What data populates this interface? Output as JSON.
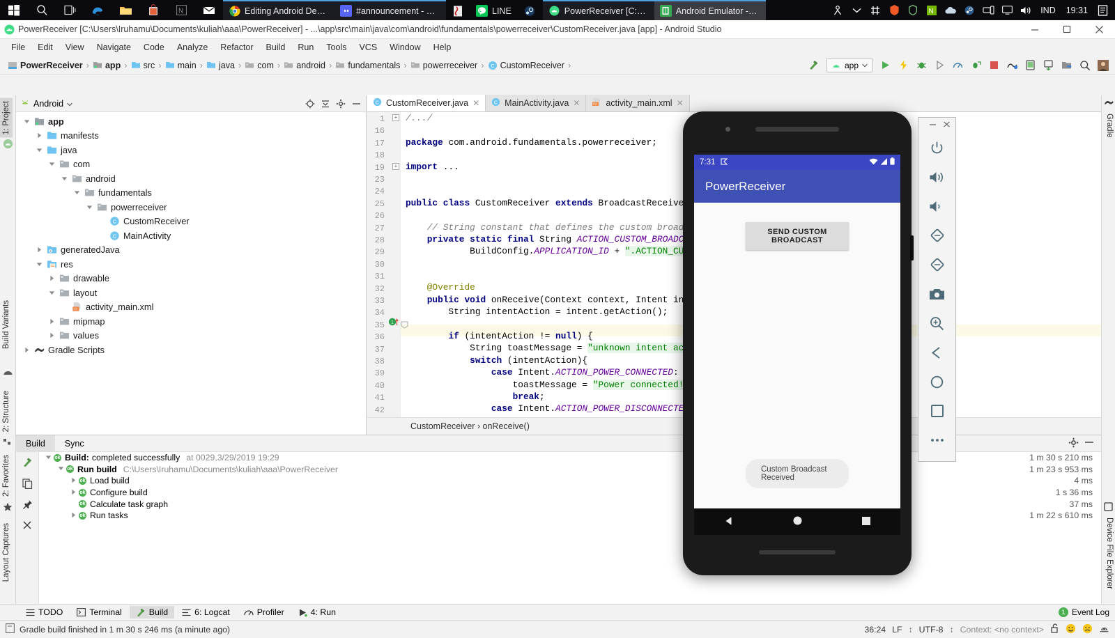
{
  "taskbar": {
    "start_label": "start-menu",
    "pinned": [
      "search-icon",
      "task-view-icon",
      "edge-icon",
      "file-explorer-icon",
      "store-icon",
      "onenote-icon",
      "mail-icon"
    ],
    "tasks": [
      {
        "label": "Editing Android Dev…",
        "icon": "chrome-icon",
        "state": "open"
      },
      {
        "label": "#announcement - D…",
        "icon": "discord-icon",
        "state": "open"
      },
      {
        "label": "",
        "icon": "pdf-icon",
        "state": "plain"
      },
      {
        "label": "LINE",
        "icon": "line-icon",
        "state": "plain"
      },
      {
        "label": "",
        "icon": "steam-icon",
        "state": "plain"
      },
      {
        "label": "PowerReceiver [C:\\U…",
        "icon": "android-studio-icon",
        "state": "open"
      },
      {
        "label": "Android Emulator - …",
        "icon": "emulator-icon",
        "state": "active"
      }
    ],
    "tray_icons": [
      "people-icon",
      "chevron-up-icon",
      "slack-icon",
      "avast-icon",
      "shield-icon",
      "nvidia-icon",
      "onedrive-icon",
      "steam-tray-icon",
      "network-icon",
      "display-icon",
      "volume-icon"
    ],
    "language": "IND",
    "clock": "19:31",
    "notification_icon": "notification-icon"
  },
  "window": {
    "title": "PowerReceiver [C:\\Users\\Iruhamu\\Documents\\kuliah\\aaa\\PowerReceiver] - ...\\app\\src\\main\\java\\com\\android\\fundamentals\\powerreceiver\\CustomReceiver.java [app] - Android Studio",
    "minimize": "—",
    "maximize": "❐",
    "close": "✕"
  },
  "menu": [
    "File",
    "Edit",
    "View",
    "Navigate",
    "Code",
    "Analyze",
    "Refactor",
    "Build",
    "Run",
    "Tools",
    "VCS",
    "Window",
    "Help"
  ],
  "breadcrumb": [
    {
      "label": "PowerReceiver",
      "icon": "module-icon",
      "bold": true
    },
    {
      "label": "app",
      "icon": "app-module-icon",
      "bold": true
    },
    {
      "label": "src",
      "icon": "folder-icon",
      "bold": false
    },
    {
      "label": "main",
      "icon": "folder-icon",
      "bold": false
    },
    {
      "label": "java",
      "icon": "java-folder-icon",
      "bold": false
    },
    {
      "label": "com",
      "icon": "package-icon",
      "bold": false
    },
    {
      "label": "android",
      "icon": "package-icon",
      "bold": false
    },
    {
      "label": "fundamentals",
      "icon": "package-icon",
      "bold": false
    },
    {
      "label": "powerreceiver",
      "icon": "package-icon",
      "bold": false
    },
    {
      "label": "CustomReceiver",
      "icon": "class-icon",
      "bold": false
    }
  ],
  "toolbar": {
    "run_config": "app",
    "buttons": [
      "build-icon",
      "run-icon",
      "debug-icon",
      "run-with-coverage-icon",
      "attach-debugger-icon",
      "profiler-icon",
      "apply-changes-icon",
      "stop-icon",
      "sync-gradle-icon",
      "avd-manager-icon",
      "sdk-manager-icon",
      "project-structure-icon",
      "search-everywhere-icon",
      "user-avatar"
    ]
  },
  "left_strip": [
    {
      "label": "1: Project",
      "selected": true
    },
    {
      "label": "Build Variants",
      "selected": false
    },
    {
      "label": "2: Structure",
      "selected": false
    },
    {
      "label": "2: Favorites",
      "selected": false
    },
    {
      "label": "Layout Captures",
      "selected": false
    }
  ],
  "right_strip": [
    {
      "label": "Gradle",
      "icon": "gradle-icon"
    },
    {
      "label": "Device File Explorer",
      "icon": "device-icon"
    }
  ],
  "project": {
    "view_name": "Android",
    "actions": [
      "locate-icon",
      "collapse-all-icon",
      "settings-icon",
      "hide-icon"
    ],
    "tree": [
      {
        "label": "app",
        "depth": 0,
        "arrow": "down",
        "icon": "app-module-icon",
        "bold": true
      },
      {
        "label": "manifests",
        "depth": 1,
        "arrow": "right",
        "icon": "folder-icon",
        "bold": false
      },
      {
        "label": "java",
        "depth": 1,
        "arrow": "down",
        "icon": "folder-icon",
        "bold": false
      },
      {
        "label": "com",
        "depth": 2,
        "arrow": "down",
        "icon": "package-icon",
        "bold": false
      },
      {
        "label": "android",
        "depth": 3,
        "arrow": "down",
        "icon": "package-icon",
        "bold": false
      },
      {
        "label": "fundamentals",
        "depth": 4,
        "arrow": "down",
        "icon": "package-icon",
        "bold": false
      },
      {
        "label": "powerreceiver",
        "depth": 5,
        "arrow": "down",
        "icon": "package-icon",
        "bold": false
      },
      {
        "label": "CustomReceiver",
        "depth": 6,
        "arrow": "none",
        "icon": "class-icon",
        "bold": false
      },
      {
        "label": "MainActivity",
        "depth": 6,
        "arrow": "none",
        "icon": "class-icon",
        "bold": false
      },
      {
        "label": "generatedJava",
        "depth": 1,
        "arrow": "right",
        "icon": "generated-folder-icon",
        "bold": false
      },
      {
        "label": "res",
        "depth": 1,
        "arrow": "down",
        "icon": "res-folder-icon",
        "bold": false
      },
      {
        "label": "drawable",
        "depth": 2,
        "arrow": "right",
        "icon": "package-icon",
        "bold": false
      },
      {
        "label": "layout",
        "depth": 2,
        "arrow": "down",
        "icon": "package-icon",
        "bold": false
      },
      {
        "label": "activity_main.xml",
        "depth": 3,
        "arrow": "none",
        "icon": "xml-icon",
        "bold": false
      },
      {
        "label": "mipmap",
        "depth": 2,
        "arrow": "right",
        "icon": "package-icon",
        "bold": false
      },
      {
        "label": "values",
        "depth": 2,
        "arrow": "right",
        "icon": "package-icon",
        "bold": false
      },
      {
        "label": "Gradle Scripts",
        "depth": 0,
        "arrow": "right",
        "icon": "gradle-icon",
        "bold": false
      }
    ]
  },
  "editor": {
    "tabs": [
      {
        "label": "CustomReceiver.java",
        "icon": "class-icon",
        "active": true
      },
      {
        "label": "MainActivity.java",
        "icon": "class-icon",
        "active": false
      },
      {
        "label": "activity_main.xml",
        "icon": "xml-icon",
        "active": false
      }
    ],
    "line_numbers": [
      1,
      16,
      17,
      18,
      19,
      23,
      24,
      25,
      26,
      27,
      28,
      29,
      30,
      31,
      32,
      33,
      34,
      35,
      36,
      37,
      38,
      39,
      40,
      41,
      42
    ],
    "highlight_line": 36,
    "gutter_marker_line": 33,
    "breadcrumb": "CustomReceiver › onReceive()",
    "code_lines": [
      "/.../",
      "",
      "package com.android.fundamentals.powerreceiver;",
      "",
      "import ...",
      "",
      "",
      "public class CustomReceiver extends BroadcastReceiver",
      "",
      "    // String constant that defines the custom broadca",
      "    private static final String ACTION_CUSTOM_BROADCAS",
      "            BuildConfig.APPLICATION_ID + \".ACTION_CUST",
      "",
      "",
      "    @Override",
      "    public void onReceive(Context context, Intent inte",
      "        String intentAction = intent.getAction();",
      "",
      "        if (intentAction != null) {",
      "            String toastMessage = \"unknown intent acti",
      "            switch (intentAction){",
      "                case Intent.ACTION_POWER_CONNECTED:",
      "                    toastMessage = \"Power connected!\";",
      "                    break;",
      "                case Intent.ACTION_POWER_DISCONNECTED:"
    ]
  },
  "build_panel": {
    "tabs": [
      {
        "label": "Build",
        "active": true
      },
      {
        "label": "Sync",
        "active": false
      }
    ],
    "actions": [
      "settings-icon",
      "hide-icon"
    ],
    "side_tools": [
      "build-hammer-icon",
      "copy-icon",
      "pin-icon",
      "close-icon"
    ],
    "rows": [
      {
        "label_bold": "Build:",
        "label": "completed successfully",
        "extra": "at 0029,3/29/2019 19:29",
        "depth": 0,
        "arrow": "down",
        "time": "1 m 30 s 210 ms"
      },
      {
        "label_bold": "Run build",
        "label": "",
        "extra": "C:\\Users\\Iruhamu\\Documents\\kuliah\\aaa\\PowerReceiver",
        "depth": 1,
        "arrow": "down",
        "time": "1 m 23 s 953 ms"
      },
      {
        "label_bold": "",
        "label": "Load build",
        "extra": "",
        "depth": 2,
        "arrow": "right",
        "time": "4 ms"
      },
      {
        "label_bold": "",
        "label": "Configure build",
        "extra": "",
        "depth": 2,
        "arrow": "right",
        "time": "1 s 36 ms"
      },
      {
        "label_bold": "",
        "label": "Calculate task graph",
        "extra": "",
        "depth": 2,
        "arrow": "none",
        "time": "37 ms"
      },
      {
        "label_bold": "",
        "label": "Run tasks",
        "extra": "",
        "depth": 2,
        "arrow": "right",
        "time": "1 m 22 s 610 ms"
      }
    ]
  },
  "tool_window_bar": {
    "items": [
      {
        "label": "TODO",
        "icon": "todo-icon",
        "active": false
      },
      {
        "label": "Terminal",
        "icon": "terminal-icon",
        "active": false
      },
      {
        "label": "Build",
        "icon": "build-hammer-icon",
        "active": true
      },
      {
        "label": "6: Logcat",
        "icon": "logcat-icon",
        "active": false
      },
      {
        "label": "Profiler",
        "icon": "profiler-icon",
        "active": false
      },
      {
        "label": "4: Run",
        "icon": "run-icon",
        "active": false
      }
    ],
    "event_log": {
      "label": "Event Log",
      "count": "1"
    }
  },
  "status_bar": {
    "message": "Gradle build finished in 1 m 30 s 246 ms (a minute ago)",
    "caret": "36:24",
    "line_sep": "LF",
    "encoding": "UTF-8",
    "context": "Context: <no context>",
    "icons": [
      "lock-open-icon",
      "happy-face-icon",
      "sad-face-icon",
      "android-face-icon"
    ]
  },
  "emulator": {
    "window_buttons": [
      "minimize-icon",
      "close-icon"
    ],
    "toolbar_icons": [
      "power-icon",
      "volume-up-icon",
      "volume-down-icon",
      "rotate-left-icon",
      "rotate-right-icon",
      "screenshot-icon",
      "zoom-icon",
      "back-icon",
      "home-icon",
      "overview-icon",
      "more-icon"
    ],
    "screen": {
      "status_time": "7:31",
      "status_icons": [
        "cast-icon",
        "wifi-icon",
        "signal-icon",
        "battery-icon"
      ],
      "app_title": "PowerReceiver",
      "button_label": "SEND CUSTOM BROADCAST",
      "toast_message": "Custom Broadcast Received",
      "nav": [
        "back-triangle-icon",
        "home-circle-icon",
        "recents-square-icon"
      ]
    },
    "colors": {
      "app_bar": "#3f51b5",
      "status_bar": "#3b46c4"
    }
  }
}
